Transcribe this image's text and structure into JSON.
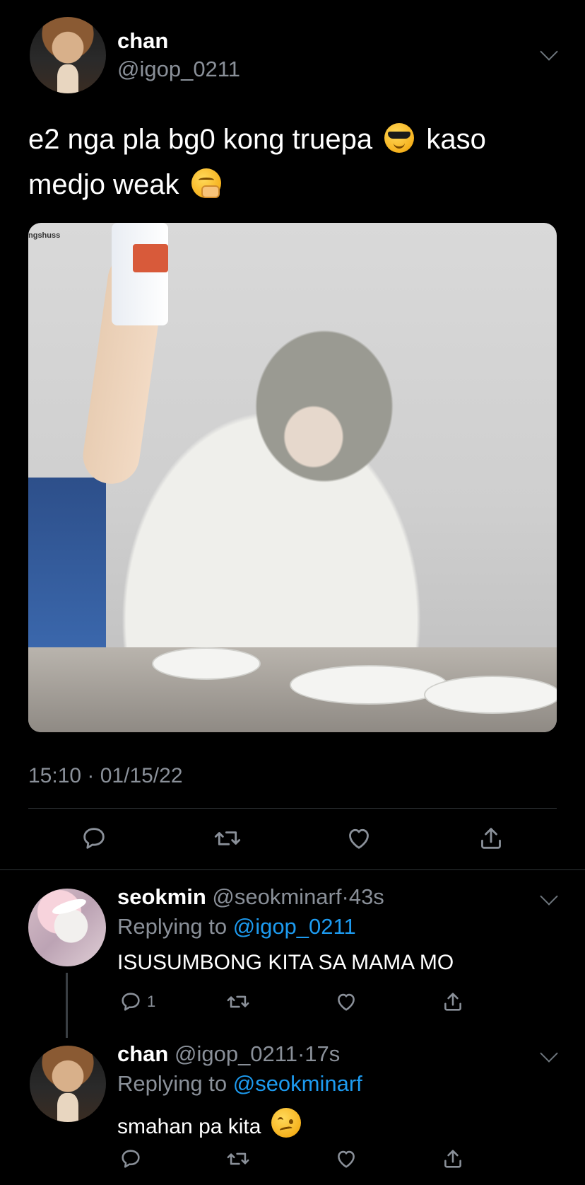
{
  "main_tweet": {
    "name": "chan",
    "handle": "@igop_0211",
    "text_line1": "e2 nga pla bg0 kong truepa",
    "text_line1_end": "kaso",
    "text_line2": "medjo weak",
    "media_watermark": "ngshuss",
    "timestamp": "15:10 · 01/15/22"
  },
  "replies": [
    {
      "name": "seokmin",
      "handle": "@seokminarf",
      "separator": "·",
      "time": "43s",
      "replying_prefix": "Replying to ",
      "replying_to": "@igop_0211",
      "text": "ISUSUMBONG KITA SA MAMA MO",
      "reply_count": "1"
    },
    {
      "name": "chan",
      "handle": "@igop_0211",
      "separator": "·",
      "time": "17s",
      "replying_prefix": "Replying to ",
      "replying_to": "@seokminarf",
      "text": "smahan pa kita",
      "reply_count": ""
    }
  ],
  "icons": {
    "reply": "speech-bubble-icon",
    "retweet": "retweet-icon",
    "like": "heart-icon",
    "share": "share-icon",
    "more": "chevron-down-icon",
    "emoji_cool": "sunglasses-face",
    "emoji_yawn": "yawning-face",
    "emoji_woozy": "woozy-face"
  },
  "colors": {
    "background": "#000000",
    "text": "#ffffff",
    "secondary": "#8a9099",
    "link": "#1d9bf0",
    "divider": "#2f3336"
  }
}
